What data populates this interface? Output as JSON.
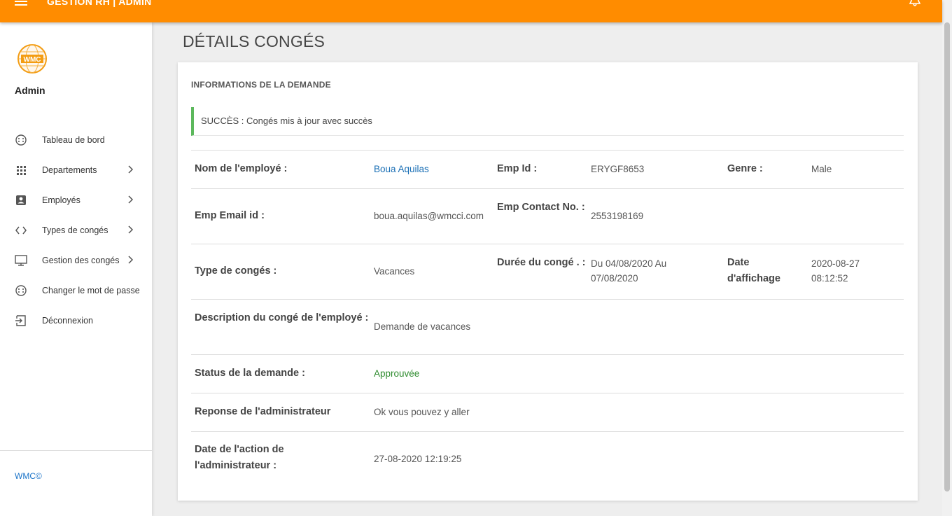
{
  "header": {
    "title": "GESTION RH | ADMIN"
  },
  "sidebar": {
    "user": "Admin",
    "items": [
      {
        "label": "Tableau de bord",
        "icon": "dashboard-icon",
        "has_submenu": false
      },
      {
        "label": "Departements",
        "icon": "grid-icon",
        "has_submenu": true
      },
      {
        "label": "Employés",
        "icon": "id-card-icon",
        "has_submenu": true
      },
      {
        "label": "Types de congés",
        "icon": "code-icon",
        "has_submenu": true
      },
      {
        "label": "Gestion des congés",
        "icon": "monitor-icon",
        "has_submenu": true
      },
      {
        "label": "Changer le mot de passe",
        "icon": "settings-icon",
        "has_submenu": false
      },
      {
        "label": "Déconnexion",
        "icon": "logout-icon",
        "has_submenu": false
      }
    ],
    "footer": "WMC©"
  },
  "page": {
    "title": "DÉTAILS CONGÉS",
    "card_title": "INFORMATIONS DE LA DEMANDE",
    "alert": "SUCCÈS : Congés mis à jour avec succès"
  },
  "details": {
    "employee_name_label": "Nom de l'employé :",
    "employee_name": "Boua Aquilas",
    "emp_id_label": "Emp Id :",
    "emp_id": "ERYGF8653",
    "gender_label": "Genre :",
    "gender": "Male",
    "email_label": "Emp Email id :",
    "email": "boua.aquilas@wmcci.com",
    "contact_label": "Emp Contact No. :",
    "contact": "2553198169",
    "leave_type_label": "Type de congés :",
    "leave_type": "Vacances",
    "duration_label": "Durée du congé . :",
    "duration": "Du 04/08/2020 Au 07/08/2020",
    "posting_date_label": "Date d'affichage",
    "posting_date": "2020-08-27 08:12:52",
    "description_label": "Description du congé de l'employé :",
    "description": "Demande de vacances",
    "status_label": "Status de la demande :",
    "status": "Approuvée",
    "admin_response_label": "Reponse de l'administrateur",
    "admin_response": "Ok vous pouvez y aller",
    "admin_action_date_label": "Date de l'action de l'administrateur :",
    "admin_action_date": "27-08-2020 12:19:25"
  },
  "colors": {
    "topbar": "#ff8c00",
    "link": "#1a6fb5",
    "success": "#2e8b2e",
    "alert_border": "#5cb85c"
  }
}
